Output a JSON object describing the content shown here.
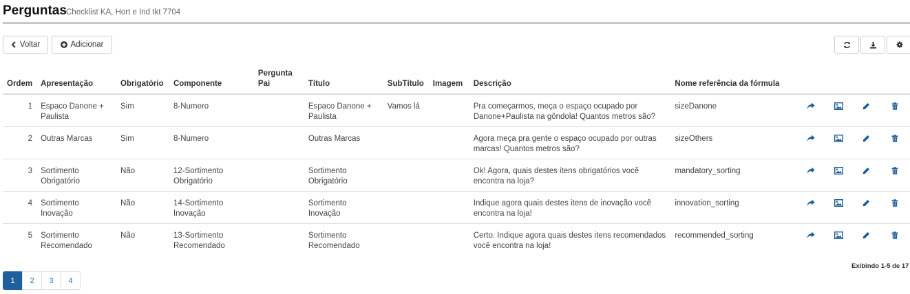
{
  "header": {
    "title": "Perguntas",
    "subtitle": "Checklist KA, Hort e Ind tkt 7704"
  },
  "toolbar": {
    "back_label": "Voltar",
    "add_label": "Adicionar",
    "refresh_icon": "refresh-icon",
    "download_icon": "download-icon",
    "settings_icon": "gear-icon"
  },
  "table": {
    "columns": {
      "ordem": "Ordem",
      "apresentacao": "Apresentação",
      "obrigatorio": "Obrigatório",
      "componente": "Componente",
      "pergunta_pai": "Pergunta Pai",
      "titulo": "Título",
      "subtitulo": "SubTítulo",
      "imagem": "Imagem",
      "descricao": "Descrição",
      "nome_ref": "Nome referência da fórmula"
    },
    "rows": [
      {
        "ordem": "1",
        "apresentacao": "Espaco Danone + Paulista",
        "obrigatorio": "Sim",
        "componente": "8-Numero",
        "pergunta_pai": "",
        "titulo": "Espaco Danone + Paulista",
        "subtitulo": "Vamos lá",
        "imagem": "",
        "descricao": "Pra começarmos, meça o espaço ocupado por Danone+Paulista na gôndola! Quantos metros são?",
        "nome_ref": "sizeDanone"
      },
      {
        "ordem": "2",
        "apresentacao": "Outras Marcas",
        "obrigatorio": "Sim",
        "componente": "8-Numero",
        "pergunta_pai": "",
        "titulo": "Outras Marcas",
        "subtitulo": "",
        "imagem": "",
        "descricao": "Agora meça pra gente o espaço ocupado por outras marcas! Quantos metros são?",
        "nome_ref": "sizeOthers"
      },
      {
        "ordem": "3",
        "apresentacao": "Sortimento Obrigatório",
        "obrigatorio": "Não",
        "componente": "12-Sortimento Obrigatório",
        "pergunta_pai": "",
        "titulo": "Sortimento Obrigatório",
        "subtitulo": "",
        "imagem": "",
        "descricao": "Ok! Agora, quais destes itens obrigatórios você encontra na loja?",
        "nome_ref": "mandatory_sorting"
      },
      {
        "ordem": "4",
        "apresentacao": "Sortimento Inovação",
        "obrigatorio": "Não",
        "componente": "14-Sortimento Inovação",
        "pergunta_pai": "",
        "titulo": "Sortimento Inovação",
        "subtitulo": "",
        "imagem": "",
        "descricao": "Indique agora quais destes itens de inovação você encontra na loja!",
        "nome_ref": "innovation_sorting"
      },
      {
        "ordem": "5",
        "apresentacao": "Sortimento Recomendado",
        "obrigatorio": "Não",
        "componente": "13-Sortimento Recomendado",
        "pergunta_pai": "",
        "titulo": "Sortimento Recomendado",
        "subtitulo": "",
        "imagem": "",
        "descricao": "Certo. Indique agora quais destes itens recomendados você encontra na loja!",
        "nome_ref": "recommended_sorting"
      }
    ],
    "row_actions": [
      "share-icon",
      "image-icon",
      "pencil-icon",
      "trash-icon"
    ]
  },
  "footer": {
    "showing": "Exibindo 1-5 de 17",
    "pages": [
      "1",
      "2",
      "3",
      "4"
    ],
    "active_page": "1"
  },
  "colors": {
    "accent": "#1e5f9e",
    "header_rule": "#1f3b57",
    "icon_blue": "#1a5a96"
  }
}
